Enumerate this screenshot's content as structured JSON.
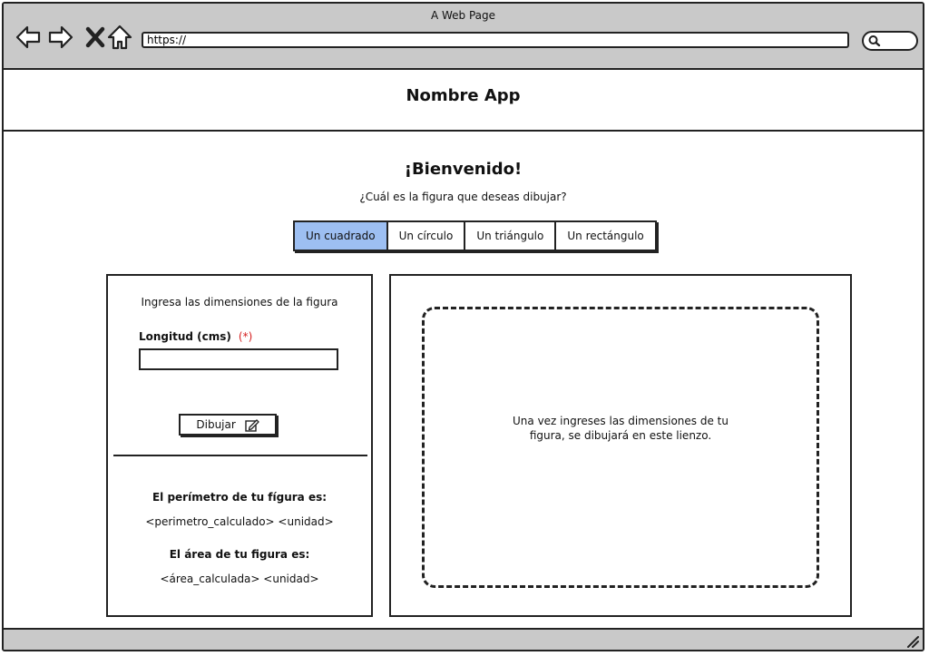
{
  "browser": {
    "title": "A Web Page",
    "url": "https://"
  },
  "app": {
    "name": "Nombre App"
  },
  "welcome": {
    "title": "¡Bienvenido!",
    "question": "¿Cuál es la figura que deseas dibujar?"
  },
  "tabs": [
    {
      "label": "Un cuadrado",
      "active": true
    },
    {
      "label": "Un círculo",
      "active": false
    },
    {
      "label": "Un triángulo",
      "active": false
    },
    {
      "label": "Un rectángulo",
      "active": false
    }
  ],
  "form": {
    "heading": "Ingresa las dimensiones de la figura",
    "length_label": "Longitud (cms)",
    "required_marker": "(*)",
    "length_value": "",
    "draw_button": "Dibujar"
  },
  "results": {
    "perimeter_title": "El perímetro de tu fígura es:",
    "perimeter_value": "<perimetro_calculado> <unidad>",
    "area_title": "El área de tu figura es:",
    "area_value": "<área_calculada>  <unidad>"
  },
  "canvas": {
    "placeholder": "Una vez ingreses las dimensiones de tu figura, se dibujará en este lienzo."
  },
  "colors": {
    "chrome": "#c9c9c9",
    "active_tab": "#9dbff2",
    "required": "#d62020"
  }
}
